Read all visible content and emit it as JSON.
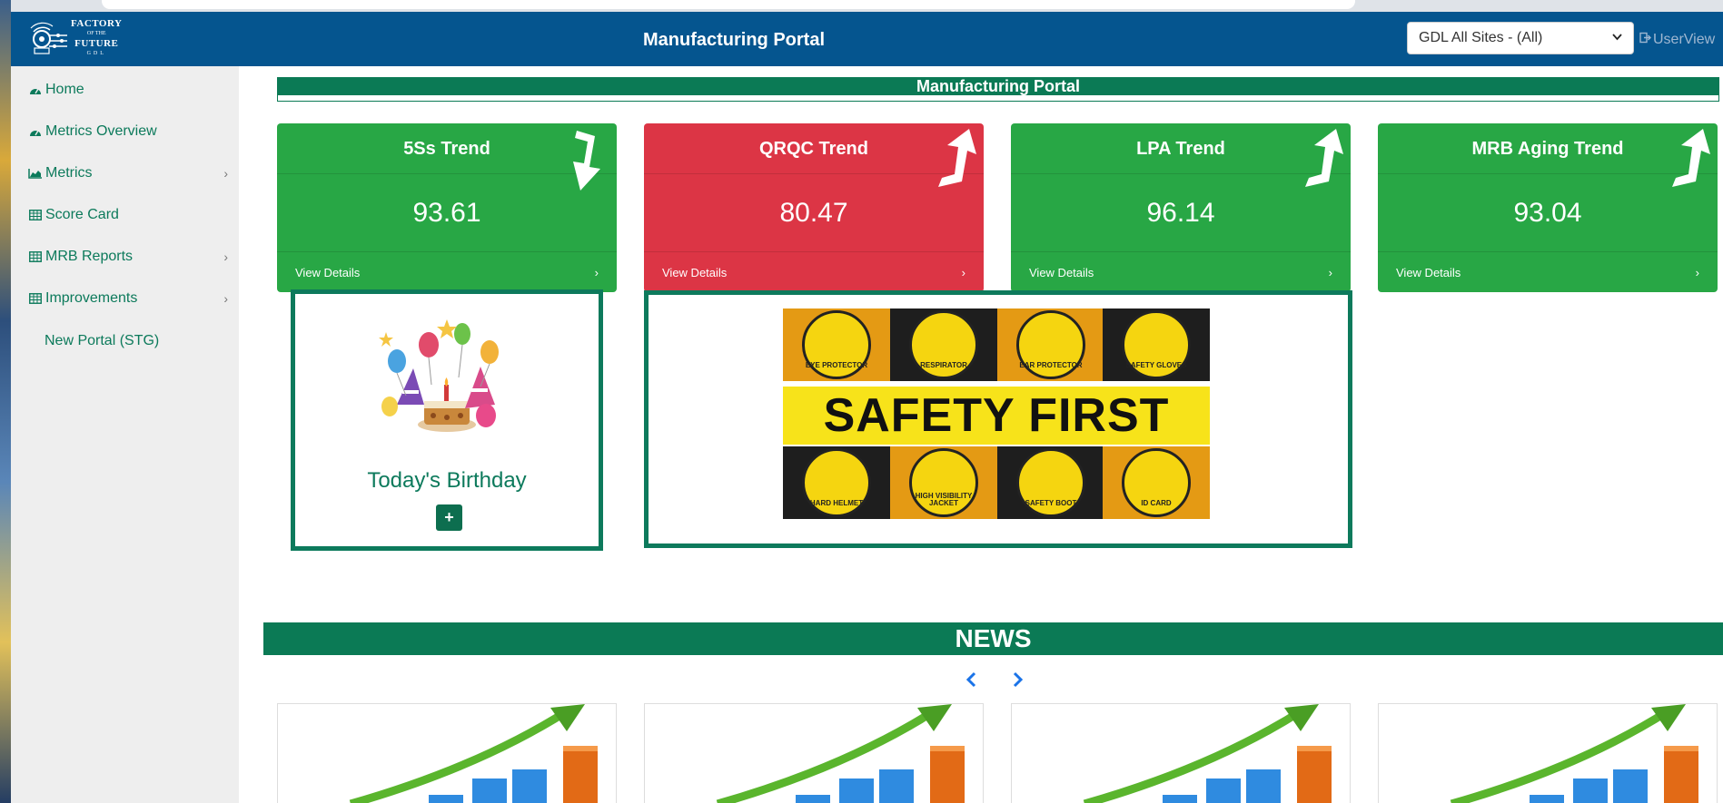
{
  "header": {
    "logo": {
      "line1": "FACTORY",
      "line2": "OF THE",
      "line3": "FUTURE",
      "line4": "GDL"
    },
    "title": "Manufacturing Portal",
    "site_select": {
      "value": "GDL All Sites - (All)"
    },
    "userview_label": "UserView",
    "colors": {
      "header_bg": "#05558f",
      "accent": "#0b7a55"
    }
  },
  "sidebar": {
    "items": [
      {
        "label": "Home",
        "icon": "dashboard-icon"
      },
      {
        "label": "Metrics Overview",
        "icon": "dashboard-icon"
      },
      {
        "label": "Metrics",
        "icon": "area-chart-icon",
        "has_submenu": true
      },
      {
        "label": "Score Card",
        "icon": "table-icon"
      },
      {
        "label": "MRB Reports",
        "icon": "table-icon",
        "has_submenu": true
      },
      {
        "label": "Improvements",
        "icon": "table-icon",
        "has_submenu": true
      },
      {
        "label": "New Portal (STG)"
      }
    ]
  },
  "main": {
    "banner_title": "Manufacturing Portal",
    "cards": [
      {
        "title": "5Ss Trend",
        "value": "93.61",
        "link": "View Details",
        "status": "green",
        "trend": "down"
      },
      {
        "title": "QRQC Trend",
        "value": "80.47",
        "link": "View Details",
        "status": "red",
        "trend": "up"
      },
      {
        "title": "LPA Trend",
        "value": "96.14",
        "link": "View Details",
        "status": "green",
        "trend": "up"
      },
      {
        "title": "MRB Aging Trend",
        "value": "93.04",
        "link": "View Details",
        "status": "green",
        "trend": "up"
      }
    ],
    "birthday": {
      "title": "Today's Birthday",
      "button": "+"
    },
    "safety_poster": {
      "banner": "SAFETY FIRST",
      "items": [
        "EYE PROTECTOR",
        "RESPIRATOR",
        "EAR PROTECTOR",
        "SAFETY GLOVES",
        "HARD HELMET",
        "HIGH VISIBILITY JACKET",
        "SAFETY BOOT",
        "ID CARD"
      ],
      "id_card_text": "ID CARD"
    },
    "news": {
      "title": "NEWS",
      "prev": "‹",
      "next": "›"
    }
  }
}
